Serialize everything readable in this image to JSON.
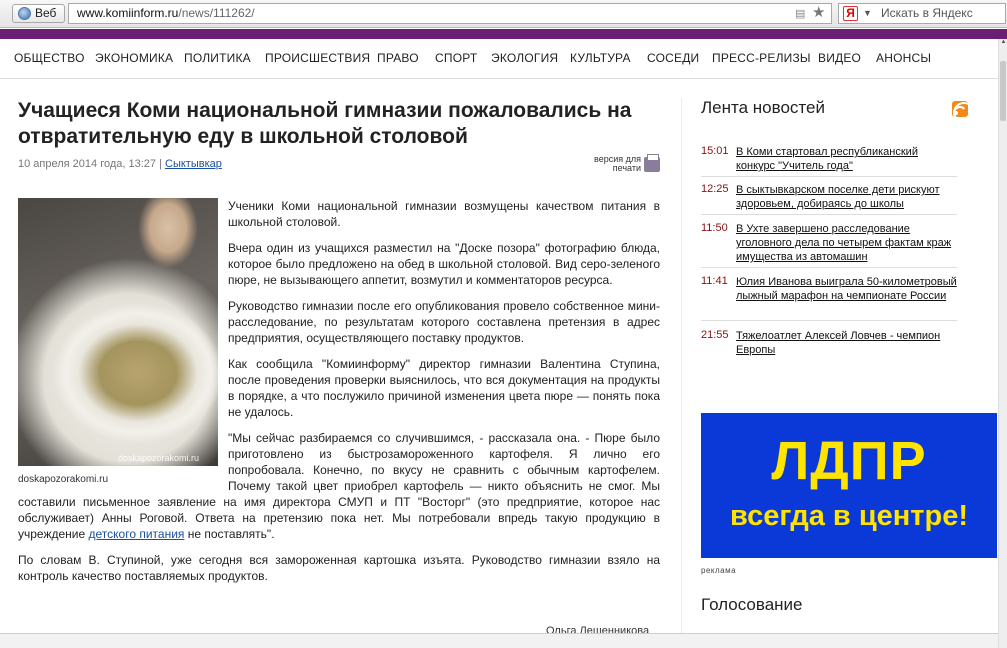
{
  "browser": {
    "web_button": "Веб",
    "url_domain": "www.komiinform.ru",
    "url_path": "/news/111262/",
    "search_placeholder": "Искать в Яндекс",
    "yandex_logo": "Я"
  },
  "nav": {
    "items": [
      "ОБЩЕСТВО",
      "ЭКОНОМИКА",
      "ПОЛИТИКА",
      "ПРОИСШЕСТВИЯ",
      "ПРАВО",
      "СПОРТ",
      "ЭКОЛОГИЯ",
      "КУЛЬТУРА",
      "СОСЕДИ",
      "ПРЕСС-РЕЛИЗЫ",
      "ВИДЕО",
      "АНОНСЫ"
    ]
  },
  "article": {
    "title": "Учащиеся Коми национальной гимназии пожаловались на отвратительную еду в школьной столовой",
    "date": "10 апреля 2014 года, 13:27",
    "separator": "|",
    "city": "Сыктывкар",
    "print_label": "версия для печати",
    "photo_watermark": "doskapozorakomi.ru",
    "photo_caption": "doskapozorakomi.ru",
    "p1": "Ученики Коми национальной гимназии возмущены качеством питания в школьной столовой.",
    "p2": "Вчера один из учащихся разместил на \"Доске позора\" фотографию блюда, которое было предложено на обед в школьной столовой. Вид серо-зеленого пюре, не вызывающего аппетит, возмутил и комментаторов ресурса.",
    "p3": "Руководство гимназии после его опубликования провело собственное мини-расследование, по результатам которого составлена претензия в адрес предприятия, осуществляющего поставку продуктов.",
    "p4": "Как сообщила \"Комиинформу\" директор гимназии Валентина Ступина, после проведения проверки выяснилось, что вся документация на продукты в порядке, а что послужило причиной изменения цвета пюре — понять пока не удалось.",
    "p5_before": "\"Мы сейчас разбираемся со случившимся, - рассказала она. - Пюре было приготовлено из быстрозамороженного картофеля. Я лично его попробовала. Конечно, по вкусу не сравнить с обычным картофелем. Почему такой цвет приобрел картофель — никто объяснить не смог. Мы составили письменное заявление на имя директора СМУП и ПТ \"Восторг\" (это предприятие, которое нас обслуживает) Анны Роговой. Ответа на претензию пока нет. Мы потребовали впредь такую продукцию в учреждение ",
    "p5_link": "детского питания",
    "p5_after": " не поставлять\".",
    "p6": "По словам В. Ступиной, уже сегодня вся замороженная картошка изъята. Руководство гимназии взяло на контроль качество поставляемых продуктов.",
    "author": "Ольга Лещенникова"
  },
  "sidebar": {
    "news_title": "Лента новостей",
    "news": [
      {
        "time": "15:01",
        "text": "В Коми стартовал республиканский конкурс \"Учитель года\""
      },
      {
        "time": "12:25",
        "text": "В сыктывкарском поселке дети рискуют здоровьем, добираясь до школы"
      },
      {
        "time": "11:50",
        "text": "В Ухте завершено расследование уголовного дела по четырем фактам краж имущества из автомашин"
      },
      {
        "time": "11:41",
        "text": "Юлия Иванова выиграла 50-километровый лыжный марафон на чемпионате России"
      },
      {
        "time": "21:55",
        "text": "Тяжелоатлет Алексей Ловчев - чемпион Европы"
      }
    ],
    "ad_line1": "ЛДПР",
    "ad_line2": "всегда в центре!",
    "ad_label": "реклама",
    "poll_title": "Голосование"
  },
  "colors": {
    "accent_bar": "#6b1f72",
    "ad_background": "#0b39d8",
    "ad_text": "#ffe400",
    "news_time": "#8a1010",
    "link": "#1a4fa0"
  },
  "icons": [
    "globe-icon",
    "rss-icon",
    "star-icon",
    "yandex-logo",
    "chevron-down-icon",
    "print-icon",
    "scroll-up-icon"
  ]
}
